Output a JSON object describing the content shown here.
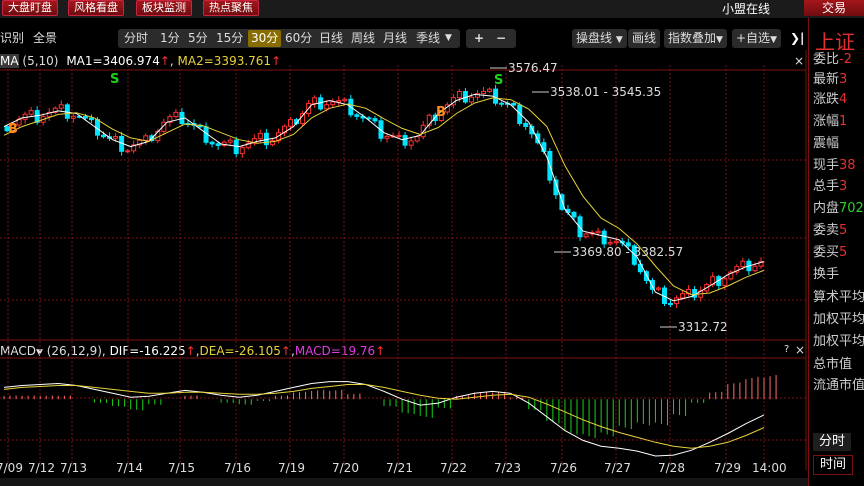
{
  "top_menu": [
    "大盘盯盘",
    "风格看盘",
    "板块监测",
    "热点聚焦"
  ],
  "status_text": "小盟在线",
  "trade_label": "交易",
  "toolbar": {
    "left": [
      "识别",
      "全景"
    ],
    "periods": [
      "分时",
      "1分",
      "5分",
      "15分",
      "30分",
      "60分",
      "日线",
      "周线",
      "月线",
      "季线"
    ],
    "selected_period": "30分",
    "zoom_in": "+",
    "zoom_out": "−",
    "right": [
      "操盘线",
      "画线",
      "指数叠加",
      "+自选"
    ],
    "chevron": "❯|"
  },
  "main_indicator": {
    "name": "MA",
    "params": "(5,10)",
    "ma1": "MA1=3406.974",
    "ma2": "MA2=3393.761"
  },
  "macd_indicator": {
    "name": "MACD",
    "params": "(26,12,9)",
    "dif": "DIF=-16.225",
    "dea": "DEA=-26.105",
    "macd": "MACD=19.76"
  },
  "right_panel": {
    "title": "上证",
    "rows": [
      {
        "label": "委比",
        "value": "-2",
        "color": "red"
      },
      {
        "label": "最新",
        "value": "3",
        "color": "red"
      },
      {
        "label": "涨跌",
        "value": "4",
        "color": "red"
      },
      {
        "label": "涨幅",
        "value": "1",
        "color": "red"
      },
      {
        "label": "震幅",
        "value": "",
        "color": "red"
      },
      {
        "label": "现手",
        "value": "38",
        "color": "red"
      },
      {
        "label": "总手",
        "value": "3",
        "color": "red"
      },
      {
        "label": "内盘",
        "value": "702",
        "color": "green"
      },
      {
        "label": "委卖",
        "value": "5",
        "color": "red"
      },
      {
        "label": "委买",
        "value": "5",
        "color": "red"
      },
      {
        "label": "换手",
        "value": "",
        "color": "red"
      },
      {
        "label": "算术平均",
        "value": "",
        "color": "red"
      },
      {
        "label": "加权平均",
        "value": "",
        "color": "red"
      },
      {
        "label": "加权平均",
        "value": "",
        "color": "red"
      },
      {
        "label": "总市值",
        "value": "",
        "color": "red"
      },
      {
        "label": "流通市值",
        "value": "",
        "color": "red"
      }
    ],
    "btn_timeshare": "分时",
    "time_label": "时间"
  },
  "colors": {
    "up": "#ff3030",
    "down": "#00e5ff",
    "ma1": "#ffffff",
    "ma2": "#e6d23a",
    "grid": "#7a1010",
    "hist_up": "#ff6a6a",
    "hist_down": "#19d219"
  },
  "chart_data": [
    {
      "type": "candlestick",
      "title": "",
      "x_labels": [
        "7/09",
        "7/12",
        "7/13",
        "7/14",
        "7/15",
        "7/16",
        "7/19",
        "7/20",
        "7/21",
        "7/22",
        "7/23",
        "7/26",
        "7/27",
        "7/28",
        "7/29",
        "14:00"
      ],
      "ylim": [
        3290,
        3600
      ],
      "annotations": [
        {
          "text": "3576.47",
          "x": "7/22",
          "y": 3576.47
        },
        {
          "text": "3538.01 - 3545.35",
          "x": "7/23",
          "y": 3541.7
        },
        {
          "text": "3369.80 - 3382.57",
          "x": "7/28",
          "y": 3376.2
        },
        {
          "text": "3312.72",
          "x": "7/28",
          "y": 3312.72
        }
      ],
      "signals": [
        {
          "text": "S",
          "x": "7/09",
          "type": "sell"
        },
        {
          "text": "B",
          "x": "7/09",
          "type": "buy"
        },
        {
          "text": "S",
          "x": "7/13",
          "type": "sell"
        },
        {
          "text": "B",
          "x": "7/22",
          "type": "buy"
        },
        {
          "text": "S",
          "x": "7/22",
          "type": "sell"
        }
      ],
      "series": [
        {
          "name": "MA1",
          "values": [
            3535,
            3545,
            3548,
            3553,
            3550,
            3535,
            3520,
            3512,
            3518,
            3540,
            3545,
            3530,
            3515,
            3512,
            3518,
            3522,
            3535,
            3560,
            3565,
            3560,
            3545,
            3528,
            3520,
            3525,
            3550,
            3565,
            3572,
            3570,
            3560,
            3540,
            3500,
            3440,
            3415,
            3410,
            3405,
            3385,
            3345,
            3335,
            3340,
            3352,
            3365,
            3374,
            3380
          ]
        },
        {
          "name": "MA2",
          "values": [
            3525,
            3535,
            3542,
            3549,
            3551,
            3545,
            3532,
            3522,
            3518,
            3528,
            3538,
            3536,
            3528,
            3520,
            3516,
            3518,
            3526,
            3545,
            3556,
            3561,
            3556,
            3544,
            3533,
            3526,
            3534,
            3550,
            3562,
            3568,
            3566,
            3555,
            3535,
            3490,
            3455,
            3430,
            3418,
            3400,
            3375,
            3352,
            3342,
            3344,
            3352,
            3362,
            3370
          ]
        }
      ]
    },
    {
      "type": "bar",
      "title": "",
      "ylim": [
        -60,
        40
      ],
      "dif": [
        12,
        14,
        15,
        16,
        14,
        10,
        6,
        2,
        3,
        6,
        9,
        7,
        4,
        2,
        4,
        8,
        12,
        16,
        18,
        18,
        15,
        8,
        0,
        -6,
        -4,
        2,
        6,
        8,
        6,
        -4,
        -18,
        -32,
        -42,
        -48,
        -50,
        -53,
        -58,
        -57,
        -52,
        -44,
        -35,
        -25,
        -16
      ],
      "dea": [
        10,
        12,
        13,
        14,
        14,
        12,
        10,
        8,
        6,
        6,
        7,
        7,
        6,
        5,
        5,
        6,
        8,
        11,
        13,
        15,
        15,
        12,
        8,
        4,
        1,
        0,
        2,
        4,
        5,
        2,
        -5,
        -13,
        -21,
        -28,
        -34,
        -39,
        -44,
        -48,
        -50,
        -48,
        -44,
        -37,
        -29
      ],
      "macd": [
        4,
        4,
        4,
        4,
        0,
        -4,
        -8,
        -12,
        -6,
        0,
        4,
        0,
        -4,
        -6,
        -2,
        4,
        8,
        10,
        10,
        6,
        0,
        -8,
        -16,
        -20,
        -10,
        4,
        8,
        8,
        2,
        -12,
        -26,
        -38,
        -42,
        -40,
        -32,
        -28,
        -28,
        -18,
        -4,
        8,
        18,
        24,
        26
      ]
    }
  ]
}
